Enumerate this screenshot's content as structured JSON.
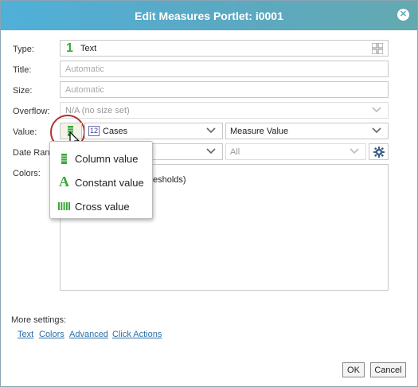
{
  "window": {
    "title": "Edit Measures Portlet: i0001",
    "close_glyph": "✕"
  },
  "form": {
    "type_label": "Type:",
    "type_value": "Text",
    "type_icon": "1",
    "title_label": "Title:",
    "title_placeholder": "Automatic",
    "size_label": "Size:",
    "size_placeholder": "Automatic",
    "overflow_label": "Overflow:",
    "overflow_value": "N/A (no size set)",
    "value_label": "Value:",
    "value_field": "Cases",
    "value_field_icon": "12",
    "value_source": "Measure Value",
    "date_range_label": "Date Rang",
    "date_range_value": "All",
    "colors_label": "Colors:",
    "colors_partial_text": "esholds)"
  },
  "value_menu": {
    "items": [
      {
        "label": "Column value",
        "icon": "column-icon"
      },
      {
        "label": "Constant value",
        "icon": "constant-icon",
        "glyph": "A"
      },
      {
        "label": "Cross value",
        "icon": "cross-icon"
      }
    ]
  },
  "more_settings": {
    "label": "More settings:",
    "links": [
      "Text",
      "Colors",
      "Advanced",
      "Click Actions"
    ]
  },
  "buttons": {
    "ok": "OK",
    "cancel": "Cancel"
  },
  "colors": {
    "title_bar_start": "#4fb0d8",
    "title_bar_end": "#63a9b0",
    "link": "#2a6fa8",
    "accent_green": "#3aa83a",
    "highlight_ring": "#b03030"
  }
}
